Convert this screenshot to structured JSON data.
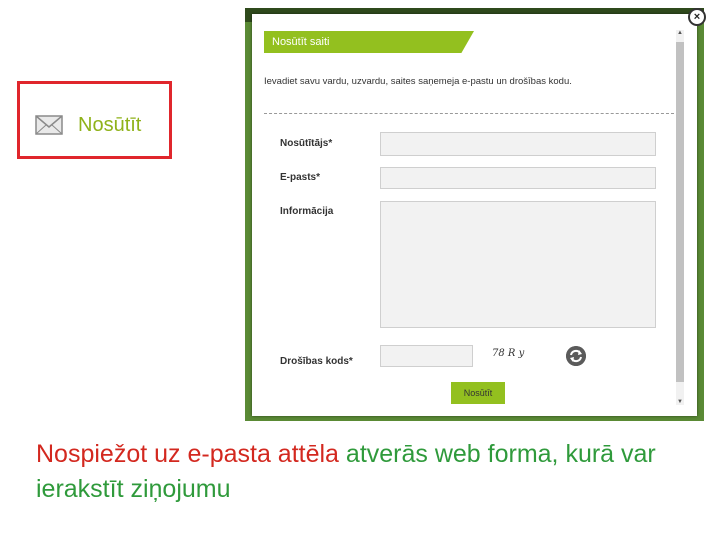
{
  "send_button": {
    "label": "Nosūtīt",
    "icon": "envelope-icon"
  },
  "form": {
    "tab_title": "Nosūtīt saiti",
    "intro": "Ievadiet savu vardu, uzvardu, saites saņemeja e-pastu un drošības kodu.",
    "fields": {
      "sender_label": "Nosūtītājs*",
      "email_label": "E-pasts*",
      "info_label": "Informācija",
      "security_label": "Drošības kods*"
    },
    "captcha_text": "78 R y",
    "submit_label": "Nosūtīt"
  },
  "caption": {
    "part1": "Nospiežot uz e-pasta attēla",
    "part2": " atverās web forma, kurā var ierakstīt ziņojumu"
  },
  "colors": {
    "accent_green": "#93c01f",
    "highlight_red": "#e0262c"
  }
}
